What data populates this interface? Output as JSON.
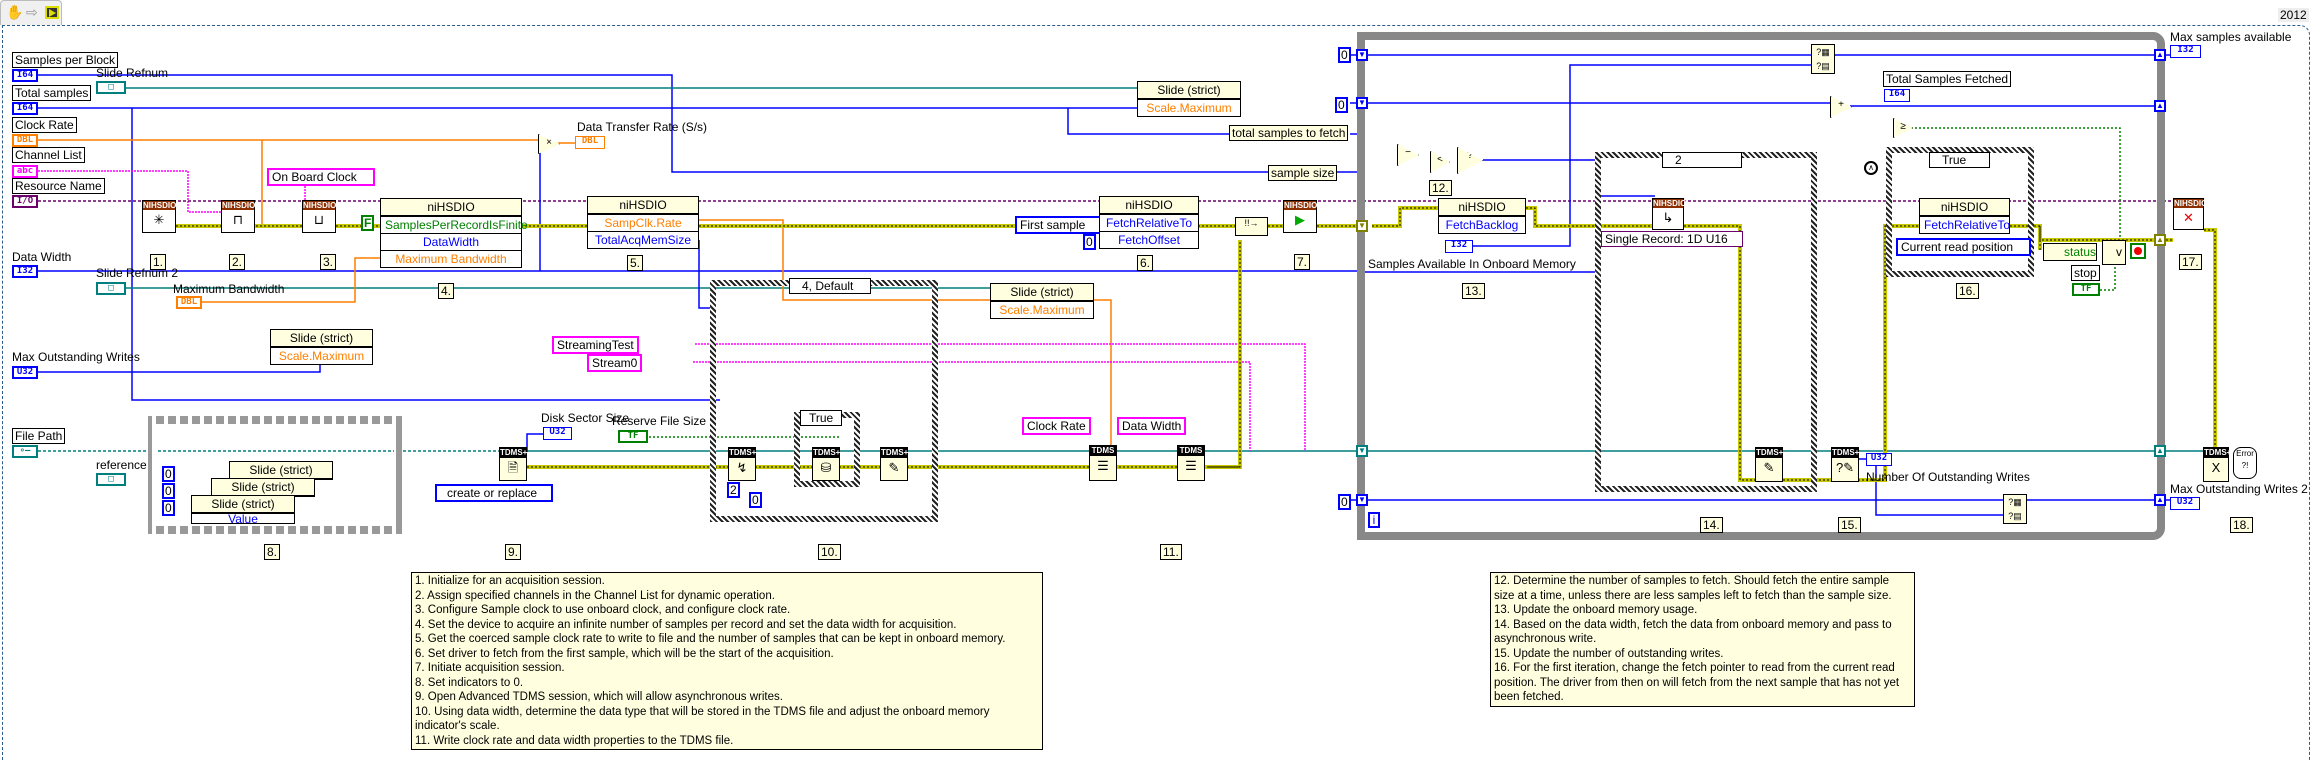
{
  "version": "2012",
  "toolbar": {
    "icons": [
      "hand-icon",
      "arrow-icon",
      "run-icon"
    ]
  },
  "colors": {
    "integer_wire": "#0000ff",
    "dbl_wire": "#ff7f00",
    "string_wire": "#ff00ff",
    "refnum_wire": "#007f7f",
    "error_wire": "#c8c800",
    "resource_wire": "#6b006b",
    "boolean_wire": "#008000",
    "comment_bg": "#ffffe0"
  },
  "controls": {
    "samples_per_block": {
      "label": "Samples per Block",
      "type": "I64"
    },
    "slide_refnum": {
      "label": "Slide Refnum"
    },
    "total_samples": {
      "label": "Total samples",
      "type": "I64"
    },
    "clock_rate": {
      "label": "Clock Rate",
      "type": "DBL"
    },
    "channel_list": {
      "label": "Channel List",
      "type": "abc"
    },
    "resource_name": {
      "label": "Resource Name",
      "type": "I/O"
    },
    "data_width": {
      "label": "Data Width",
      "type": "I32"
    },
    "slide_refnum_2": {
      "label": "Slide Refnum 2"
    },
    "maximum_bandwidth": {
      "label": "Maximum Bandwidth",
      "type": "DBL"
    },
    "max_outstanding_writes": {
      "label": "Max Outstanding Writes",
      "type": "U32"
    },
    "file_path": {
      "label": "File Path"
    },
    "reference": {
      "label": "reference"
    },
    "reserve_file_size": {
      "label": "Reserve File Size",
      "type": "TF"
    },
    "stop": {
      "label": "stop",
      "type": "TF"
    }
  },
  "indicators": {
    "data_transfer_rate": {
      "label": "Data Transfer Rate (S/s)",
      "type": "DBL"
    },
    "disk_sector_size": {
      "label": "Disk Sector Size",
      "type": "U32"
    },
    "samples_available": {
      "label": "Samples Available In Onboard Memory",
      "type": "I32"
    },
    "total_samples_fetched": {
      "label": "Total Samples Fetched",
      "type": "I64"
    },
    "max_samples_available": {
      "label": "Max samples available",
      "type": "I32"
    },
    "outstanding_writes": {
      "label": "Number Of Outstanding Writes",
      "type": "U32"
    },
    "max_outstanding_writes_2": {
      "label": "Max Outstanding Writes 2",
      "type": "U32"
    }
  },
  "nodes": {
    "subvi_header": "NIHSDIO",
    "tdms_plus_header": "TDMS+",
    "tdms_header": "TDMS",
    "prop_4": {
      "title": "niHSDIO",
      "rows": [
        "SamplesPerRecordIsFinite",
        "DataWidth",
        "Maximum Bandwidth"
      ]
    },
    "prop_5": {
      "title": "niHSDIO",
      "rows": [
        "SampClk.Rate",
        "TotalAcqMemSize"
      ]
    },
    "prop_6": {
      "title": "niHSDIO",
      "rows": [
        "FetchRelativeTo",
        "FetchOffset"
      ]
    },
    "prop_13": {
      "title": "niHSDIO",
      "rows": [
        "FetchBacklog"
      ]
    },
    "prop_16": {
      "title": "niHSDIO",
      "rows": [
        "FetchRelativeTo"
      ]
    },
    "slide": {
      "title": "Slide (strict)",
      "scale_max": "Scale.Maximum",
      "value": "Value"
    },
    "status": "status"
  },
  "constants": {
    "on_board_clock": "On Board Clock",
    "false": "F",
    "first_sample": "First sample",
    "zero": "0",
    "two": "2",
    "create_or_replace": "create or replace",
    "streaming_test": "StreamingTest",
    "stream0": "Stream0",
    "clock_rate": "Clock Rate",
    "data_width": "Data Width",
    "single_record": "Single Record: 1D U16",
    "current_read_position": "Current read position"
  },
  "locals": {
    "total_samples_to_fetch": "total samples to fetch",
    "sample_size": "sample size"
  },
  "cases": {
    "case_10": "4, Default",
    "case_10_inner": "True",
    "case_14": "2",
    "case_16": "True"
  },
  "loop_iteration": "i",
  "steps": [
    "1.",
    "2.",
    "3.",
    "4.",
    "5.",
    "6.",
    "7.",
    "8.",
    "9.",
    "10.",
    "11.",
    "12.",
    "13.",
    "14.",
    "15.",
    "16.",
    "17.",
    "18."
  ],
  "comments": {
    "left": [
      "1. Initialize for an acquisition session.",
      "2. Assign specified channels in the Channel List for dynamic operation.",
      "3. Configure Sample clock to use onboard clock, and configure clock rate.",
      "4. Set the device to acquire an infinite number of samples per record and set the data width for acquisition.",
      "5. Get the coerced sample clock rate to write to file and the number of samples that can be kept in onboard memory.",
      "6. Set driver to fetch from the first sample, which will be the start of the acquisition.",
      "7. Initiate acquisition session.",
      "8. Set indicators to 0.",
      "9. Open Advanced TDMS session, which will allow asynchronous writes.",
      "10. Using data width, determine the data type that will be stored in the TDMS file and adjust the onboard memory indicator's scale.",
      "11. Write clock rate and data width properties to the TDMS file."
    ],
    "right": [
      "12. Determine the number of samples to fetch. Should fetch the entire sample size at a time, unless there are less samples left to fetch than the sample size.",
      "13. Update the onboard memory usage.",
      "14. Based on the data width, fetch the data from onboard memory and pass to asynchronous write.",
      "15. Update the number of outstanding writes.",
      "16. For the first iteration, change the fetch pointer to read from the current read position.  The driver from then on will fetch from the next sample that has not yet been fetched."
    ]
  }
}
